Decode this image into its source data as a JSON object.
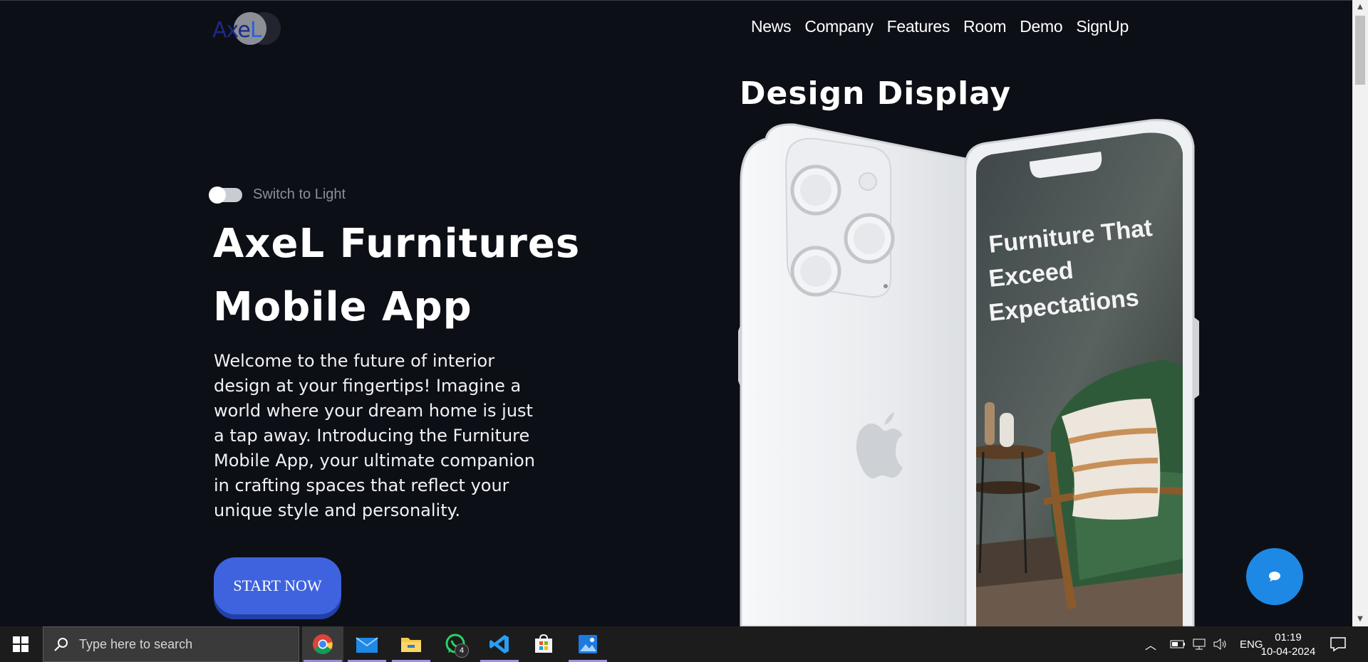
{
  "logo": {
    "text_a": "Axe",
    "text_b": "L",
    "icon": "axel-logo"
  },
  "nav": {
    "items": [
      "News",
      "Company",
      "Features",
      "Room",
      "Demo",
      "SignUp"
    ]
  },
  "theme_toggle": {
    "label": "Switch to Light"
  },
  "hero": {
    "title_line1": "AxeL Furnitures",
    "title_line2": "Mobile App",
    "description": "Welcome to the future of interior design at your fingertips! Imagine a world where your dream home is just a tap away. Introducing the Furniture Mobile App, your ultimate companion in crafting spaces that reflect your unique style and personality.",
    "cta_label": "START NOW"
  },
  "design": {
    "title": "Design Display",
    "screen_lines": [
      "Furniture That",
      "Exceed",
      "Expectations"
    ]
  },
  "chat_button": {
    "icon": "chat-bubble-icon"
  },
  "taskbar": {
    "search_placeholder": "Type here to search",
    "apps": [
      "chrome",
      "mail",
      "file-explorer",
      "whatsapp",
      "vscode",
      "microsoft-store",
      "photos"
    ],
    "whatsapp_badge": "4",
    "language": "ENG",
    "time": "01:19",
    "date": "10-04-2024"
  },
  "colors": {
    "background": "#0d0f16",
    "accent": "#3f63de",
    "chat": "#1e88e5"
  }
}
